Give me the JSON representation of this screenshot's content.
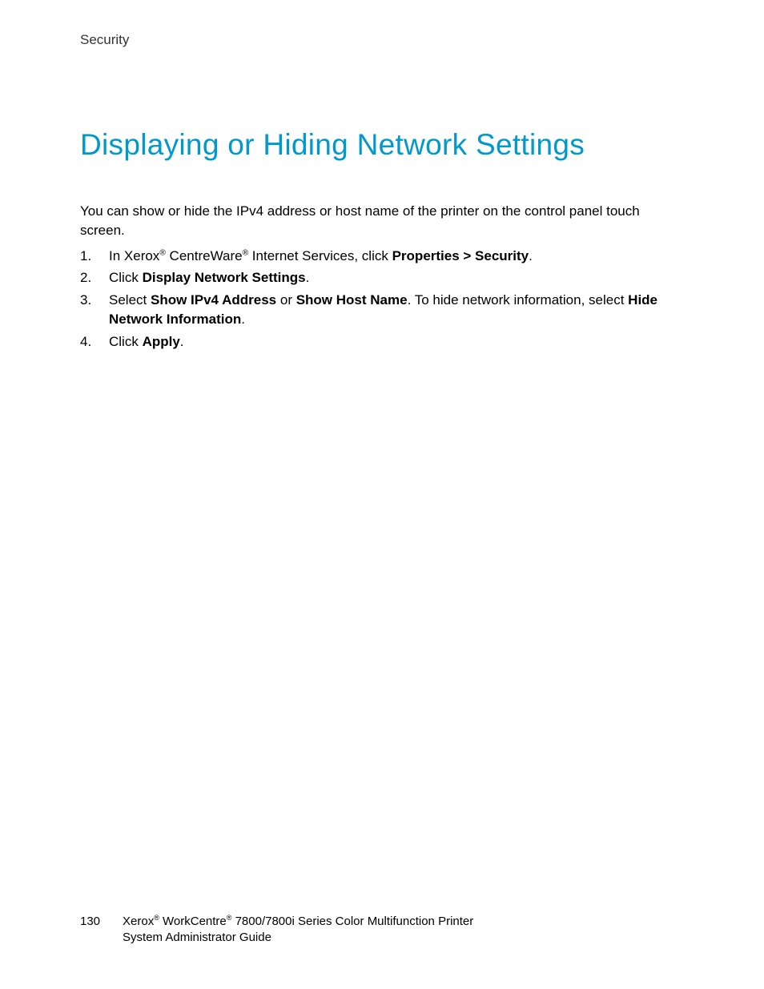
{
  "header": {
    "section_label": "Security"
  },
  "main": {
    "title": "Displaying or Hiding Network Settings",
    "intro": "You can show or hide the IPv4 address or host name of the printer on the control panel touch screen.",
    "steps": [
      {
        "num": "1.",
        "pre1": "In Xerox",
        "reg1": "®",
        "mid1": " CentreWare",
        "reg2": "®",
        "mid2": " Internet Services, click ",
        "bold1": "Properties > Security",
        "post": "."
      },
      {
        "num": "2.",
        "pre1": "Click ",
        "bold1": "Display Network Settings",
        "post": "."
      },
      {
        "num": "3.",
        "pre1": "Select ",
        "bold1": "Show IPv4 Address",
        "mid1": " or ",
        "bold2": "Show Host Name",
        "mid2": ". To hide network information, select ",
        "bold3": "Hide Network Information",
        "post": "."
      },
      {
        "num": "4.",
        "pre1": "Click ",
        "bold1": "Apply",
        "post": "."
      }
    ]
  },
  "footer": {
    "page_number": "130",
    "line1_a": "Xerox",
    "line1_reg1": "®",
    "line1_b": " WorkCentre",
    "line1_reg2": "®",
    "line1_c": " 7800/7800i Series Color Multifunction Printer",
    "line2": "System Administrator Guide"
  }
}
